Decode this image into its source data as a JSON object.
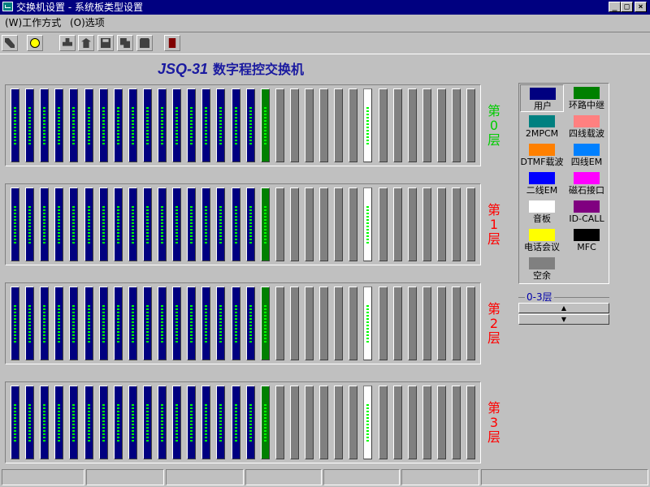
{
  "window": {
    "title": "交换机设置 - 系统板类型设置"
  },
  "menu": [
    {
      "label": "(W)工作方式"
    },
    {
      "label": "(O)选项"
    }
  ],
  "toolbar": {
    "buttons": [
      {
        "name": "tool-wand-icon"
      },
      {
        "name": "smiley-icon"
      },
      {
        "name": "print-icon"
      },
      {
        "name": "network-icon"
      },
      {
        "name": "save-icon"
      },
      {
        "name": "copy-icon"
      },
      {
        "name": "paste-icon"
      },
      {
        "name": "exit-icon"
      }
    ]
  },
  "heading": {
    "model": "JSQ-31",
    "name": "数字程控交换机"
  },
  "layers": [
    {
      "label": "第0层",
      "color": "#00cc00"
    },
    {
      "label": "第1层",
      "color": "#ff0000"
    },
    {
      "label": "第2层",
      "color": "#ff0000"
    },
    {
      "label": "第3层",
      "color": "#ff0000"
    }
  ],
  "slot_pattern": [
    "user",
    "user",
    "user",
    "user",
    "user",
    "user",
    "user",
    "user",
    "user",
    "user",
    "user",
    "user",
    "user",
    "user",
    "user",
    "user",
    "user",
    "trunk",
    "empty",
    "empty",
    "empty",
    "empty",
    "empty",
    "empty",
    "tone",
    "empty",
    "empty",
    "empty",
    "empty",
    "empty",
    "empty",
    "empty"
  ],
  "board_types": [
    {
      "label": "用户",
      "color": "#000080",
      "selected": true
    },
    {
      "label": "环路中继",
      "color": "#008000"
    },
    {
      "label": "2MPCM",
      "color": "#008080"
    },
    {
      "label": "四线载波",
      "color": "#ff8080"
    },
    {
      "label": "DTMF载波",
      "color": "#ff8000"
    },
    {
      "label": "四线EM",
      "color": "#0080ff"
    },
    {
      "label": "二线EM",
      "color": "#0000ff"
    },
    {
      "label": "磁石接口",
      "color": "#ff00ff"
    },
    {
      "label": "音板",
      "color": "#ffffff"
    },
    {
      "label": "ID-CALL",
      "color": "#800080"
    },
    {
      "label": "电话会议",
      "color": "#ffff00"
    },
    {
      "label": "MFC",
      "color": "#000000"
    },
    {
      "label": "空余",
      "color": "#808080"
    }
  ],
  "layer_range": {
    "label": "0-3层",
    "up": "▲",
    "down": "▼"
  }
}
